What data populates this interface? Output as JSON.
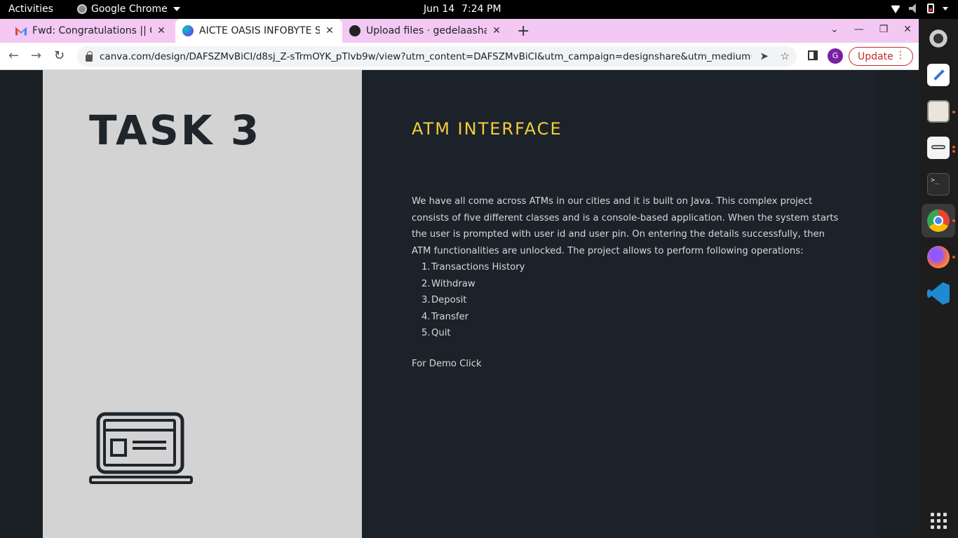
{
  "topbar": {
    "activities": "Activities",
    "app_name": "Google Chrome",
    "date": "Jun 14",
    "time": "7:24 PM"
  },
  "tabs": [
    {
      "title": "Fwd: Congratulations || O",
      "icon": "gmail-icon"
    },
    {
      "title": "AICTE OASIS INFOBYTE SI",
      "icon": "canva-icon"
    },
    {
      "title": "Upload files · gedelaasha-",
      "icon": "github-icon"
    }
  ],
  "toolbar": {
    "url": "canva.com/design/DAFSZMvBiCI/d8sj_Z-sTrmOYK_pTlvb9w/view?utm_content=DAFSZMvBiCI&utm_campaign=designshare&utm_medium=link&...",
    "profile_initial": "G",
    "update_label": "Update"
  },
  "slide": {
    "task_title": "TASK 3",
    "heading": "ATM INTERFACE",
    "description": "We have all come across ATMs in our cities and it is built on Java. This complex project consists of five different classes and is a console-based application. When the system starts the user is prompted with user id and user pin. On entering the details successfully, then ATM functionalities are unlocked. The project allows to perform following operations:",
    "operations": [
      {
        "num": "1.",
        "label": "Transactions History"
      },
      {
        "num": "2.",
        "label": "Withdraw"
      },
      {
        "num": "3.",
        "label": "Deposit"
      },
      {
        "num": "4.",
        "label": "Transfer"
      },
      {
        "num": "5.",
        "label": "Quit"
      }
    ],
    "demo_text": "For Demo Click",
    "heading_color": "#f2cd3a"
  },
  "dock": {
    "items": [
      "settings-icon",
      "text-editor-icon",
      "files-icon",
      "document-viewer-icon",
      "terminal-icon",
      "chrome-icon",
      "firefox-icon",
      "vscode-icon"
    ]
  }
}
